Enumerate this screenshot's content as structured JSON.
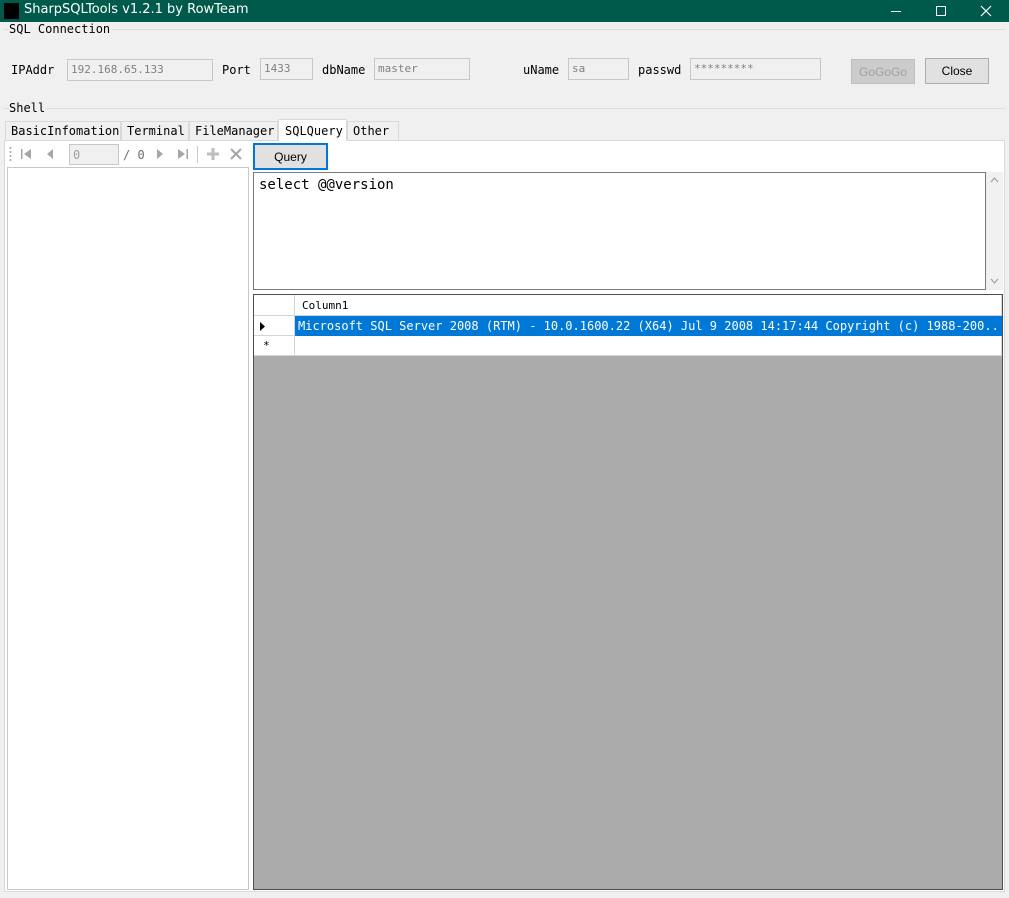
{
  "window": {
    "title": "SharpSQLTools v1.2.1 by RowTeam",
    "minimize_glyph": "—",
    "maximize_glyph": "☐",
    "close_glyph": "✕"
  },
  "connection": {
    "group_label": "SQL Connection",
    "ip_label": "IPAddr",
    "ip_value": "192.168.65.133",
    "port_label": "Port",
    "port_value": "1433",
    "db_label": "dbName",
    "db_value": "master",
    "user_label": "uName",
    "user_value": "sa",
    "pass_label": "passwd",
    "pass_value": "*********",
    "gogogo_label": "GoGoGo",
    "close_label": "Close"
  },
  "shell": {
    "group_label": "Shell",
    "tabs": [
      {
        "label": "BasicInfomation"
      },
      {
        "label": "Terminal"
      },
      {
        "label": "FileManager"
      },
      {
        "label": "SQLQuery"
      },
      {
        "label": "Other"
      }
    ],
    "active_tab": "SQLQuery"
  },
  "navigator": {
    "position": "0",
    "count": "/ 0",
    "icons": [
      "move-first-icon",
      "move-previous-icon",
      "move-next-icon",
      "move-last-icon",
      "add-new-icon",
      "delete-icon"
    ]
  },
  "query": {
    "button_label": "Query",
    "sql_text": "select @@version"
  },
  "results": {
    "columns": [
      "Column1"
    ],
    "rows": [
      [
        "Microsoft SQL Server 2008 (RTM) - 10.0.1600.22 (X64) Jul  9 2008 14:17:44 Copyright (c) 1988-200..."
      ]
    ],
    "new_row_marker": "*",
    "selection_color": "#0078d7"
  },
  "colors": {
    "titlebar": "#005a4b",
    "grid_background": "#ababab"
  }
}
